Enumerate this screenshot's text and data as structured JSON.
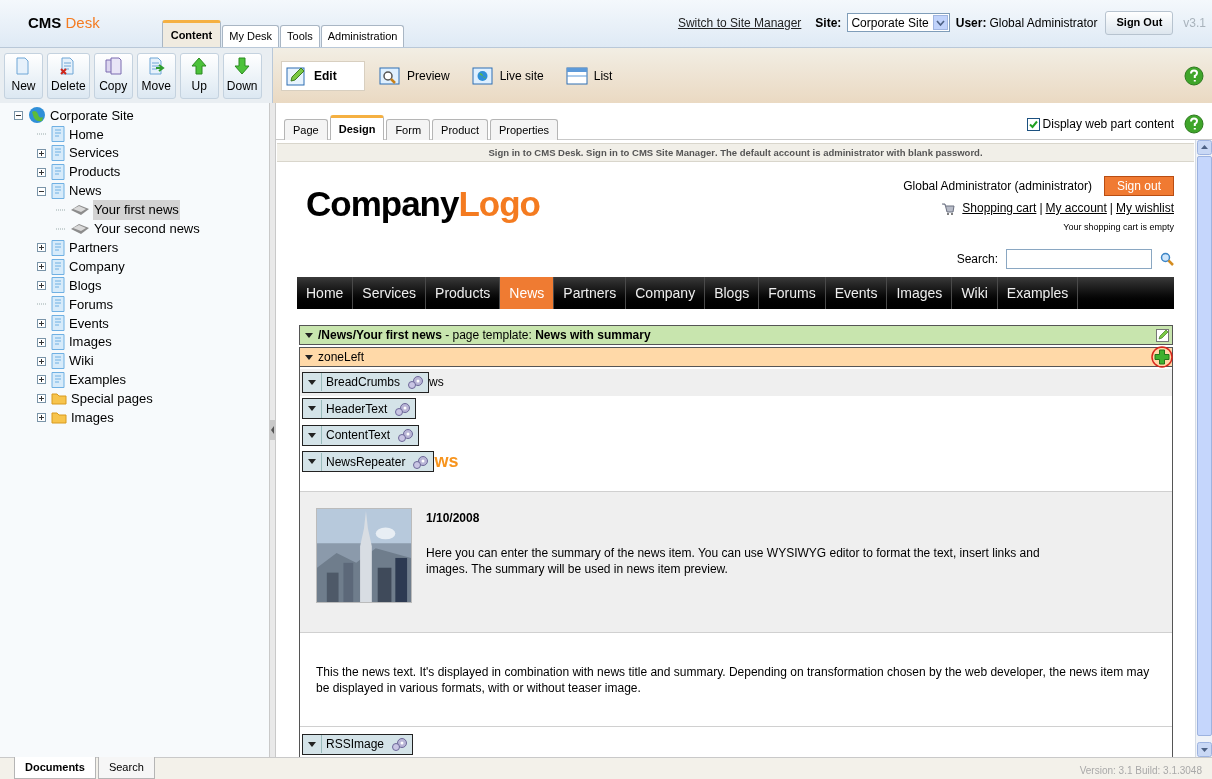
{
  "header": {
    "logo": {
      "main": "CMS",
      "accent": "Desk"
    },
    "tabs": [
      {
        "label": "Content",
        "selected": true
      },
      {
        "label": "My Desk",
        "selected": false
      },
      {
        "label": "Tools",
        "selected": false
      },
      {
        "label": "Administration",
        "selected": false
      }
    ],
    "switch_link": "Switch to Site Manager",
    "site_label": "Site:",
    "site_value": "Corporate Site",
    "user_label": "User:",
    "user_name": "Global Administrator",
    "sign_out": "Sign Out",
    "version": "v3.1"
  },
  "toolbar": {
    "buttons": [
      "New",
      "Delete",
      "Copy",
      "Move",
      "Up",
      "Down"
    ],
    "view_modes": [
      {
        "label": "Edit",
        "selected": true
      },
      {
        "label": "Preview",
        "selected": false
      },
      {
        "label": "Live site",
        "selected": false
      },
      {
        "label": "List",
        "selected": false
      }
    ]
  },
  "tree": {
    "label": "Corporate Site",
    "expanded": true,
    "children": [
      {
        "label": "Home",
        "kind": "page",
        "selected": false
      },
      {
        "label": "Services",
        "kind": "page",
        "expanded": false,
        "selected": false
      },
      {
        "label": "Products",
        "kind": "page",
        "expanded": false,
        "selected": false
      },
      {
        "label": "News",
        "kind": "page",
        "expanded": true,
        "selected": false,
        "children": [
          {
            "label": "Your first news",
            "kind": "news",
            "selected": true
          },
          {
            "label": "Your second news",
            "kind": "news",
            "selected": false
          }
        ]
      },
      {
        "label": "Partners",
        "kind": "page",
        "expanded": false,
        "selected": false
      },
      {
        "label": "Company",
        "kind": "page",
        "expanded": false,
        "selected": false
      },
      {
        "label": "Blogs",
        "kind": "page",
        "expanded": false,
        "selected": false
      },
      {
        "label": "Forums",
        "kind": "page",
        "selected": false
      },
      {
        "label": "Events",
        "kind": "page",
        "expanded": false,
        "selected": false
      },
      {
        "label": "Images",
        "kind": "page",
        "expanded": false,
        "selected": false
      },
      {
        "label": "Wiki",
        "kind": "page",
        "expanded": false,
        "selected": false
      },
      {
        "label": "Examples",
        "kind": "page",
        "expanded": false,
        "selected": false
      },
      {
        "label": "Special pages",
        "kind": "folder",
        "expanded": false,
        "selected": false
      },
      {
        "label": "Images",
        "kind": "folder",
        "expanded": false,
        "selected": false
      }
    ]
  },
  "content_tabs": [
    {
      "label": "Page",
      "selected": false
    },
    {
      "label": "Design",
      "selected": true
    },
    {
      "label": "Form",
      "selected": false
    },
    {
      "label": "Product",
      "selected": false
    },
    {
      "label": "Properties",
      "selected": false
    }
  ],
  "display_web_part_content": {
    "label": "Display web part content",
    "checked": true
  },
  "info_bar": "Sign in to **CMS Desk**. Sign in to **CMS Site Manager**. The default account is administrator with blank password.",
  "site": {
    "logo": {
      "main": "Company",
      "accent": "Logo"
    },
    "user": "Global Administrator (administrator)",
    "sign_out": "Sign out",
    "links": [
      {
        "kind": "link",
        "text": "Shopping cart"
      },
      {
        "kind": "separator",
        "text": "|"
      },
      {
        "kind": "link",
        "text": "My account"
      },
      {
        "kind": "separator",
        "text": "|"
      },
      {
        "kind": "link",
        "text": "My wishlist"
      }
    ],
    "cart_status": "Your shopping cart is empty",
    "search_label": "Search:",
    "menu": [
      {
        "label": "Home",
        "selected": false
      },
      {
        "label": "Services",
        "selected": false
      },
      {
        "label": "Products",
        "selected": false
      },
      {
        "label": "News",
        "selected": true
      },
      {
        "label": "Partners",
        "selected": false
      },
      {
        "label": "Company",
        "selected": false
      },
      {
        "label": "Blogs",
        "selected": false
      },
      {
        "label": "Forums",
        "selected": false
      },
      {
        "label": "Events",
        "selected": false
      },
      {
        "label": "Images",
        "selected": false
      },
      {
        "label": "Wiki",
        "selected": false
      },
      {
        "label": "Examples",
        "selected": false
      }
    ]
  },
  "template_bar": "**/News/Your first news** - page template: **News with summary**",
  "zone": "zoneLeft",
  "web_parts": [
    {
      "name": "BreadCrumbs",
      "behind": "ws"
    },
    {
      "name": "HeaderText"
    },
    {
      "name": "ContentText"
    },
    {
      "name": "NewsRepeater",
      "behind": "ws"
    }
  ],
  "news_item": {
    "date": "1/10/2008",
    "summary": "Here you can enter the summary of the news item. You can use WYSIWYG editor to format the text, insert links and images. The summary will be used in news item preview.",
    "text": "This the news text. It's displayed in combination with news title and summary. Depending on transformation chosen by the web developer, the news item may be displayed in various formats, with or without teaser image."
  },
  "last_web_part": "RSSImage",
  "bottom_tabs": [
    {
      "label": "Documents",
      "selected": true
    },
    {
      "label": "Search",
      "selected": false
    }
  ],
  "version": "Version: 3.1 Build: 3.1.3048"
}
